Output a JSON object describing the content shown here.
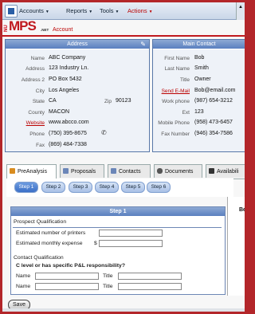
{
  "menubar": {
    "items": [
      {
        "label": "Accounts",
        "has_arrow": true
      },
      {
        "label": "Reports",
        "has_arrow": true
      },
      {
        "label": "Tools",
        "has_arrow": true
      },
      {
        "label": "Actions",
        "has_arrow": true
      }
    ]
  },
  "logo": {
    "prefix": "NU",
    "name": "MPS",
    "suffix": ".NET"
  },
  "breadcrumb": "Account",
  "address_panel": {
    "title": "Address",
    "name_label": "Name",
    "name": "ABC Company",
    "address_label": "Address",
    "address": "123 Industry Ln.",
    "address2_label": "Address 2",
    "address2": "PO Box 5432",
    "city_label": "City",
    "city": "Los Angeles",
    "state_label": "State",
    "state": "CA",
    "zip_label": "Zip",
    "zip": "90123",
    "county_label": "County",
    "county": "MACON",
    "website_label": "Website",
    "website": "www.abcco.com",
    "phone_label": "Phone",
    "phone": "(750) 395-8675",
    "fax_label": "Fax",
    "fax": "(869) 484-7338"
  },
  "contact_panel": {
    "title": "Main Contact",
    "first_label": "First Name",
    "first": "Bob",
    "last_label": "Last Name",
    "last": "Smith",
    "title_label": "Title",
    "title_value": "Owner",
    "email_label": "Send E-Mail",
    "email": "Bob@email.com",
    "work_label": "Work phone",
    "work": "(987) 654-3212",
    "ext_label": "Ext",
    "ext": "123",
    "mobile_label": "Mobile Phone",
    "mobile": "(958) 473-6457",
    "fax_label": "Fax Number",
    "fax": "(946) 354-7586"
  },
  "tabs": [
    {
      "label": "PreAnalysis",
      "active": true,
      "icon_color": "#d98c1f"
    },
    {
      "label": "Proposals",
      "active": false,
      "icon_color": "#6b86b8"
    },
    {
      "label": "Contacts",
      "active": false,
      "icon_color": "#6b86b8"
    },
    {
      "label": "Documents",
      "active": false,
      "icon_color": "#555555"
    },
    {
      "label": "Availabili",
      "active": false,
      "icon_color": "#333333"
    }
  ],
  "steps": [
    "Step 1",
    "Step 2",
    "Step 3",
    "Step 4",
    "Step 5",
    "Step 6"
  ],
  "right_cut_label": "Be",
  "step_panel": {
    "title": "Step 1",
    "prospect_heading": "Prospect Qualification",
    "printers_label": "Estimated number of printers",
    "expense_label": "Estimated monthly expense",
    "currency": "$",
    "contact_heading": "Contact Qualification",
    "question": "C level or has specific P&L responsibility?",
    "name_label": "Name",
    "title_label": "Title"
  },
  "save_label": "Save"
}
